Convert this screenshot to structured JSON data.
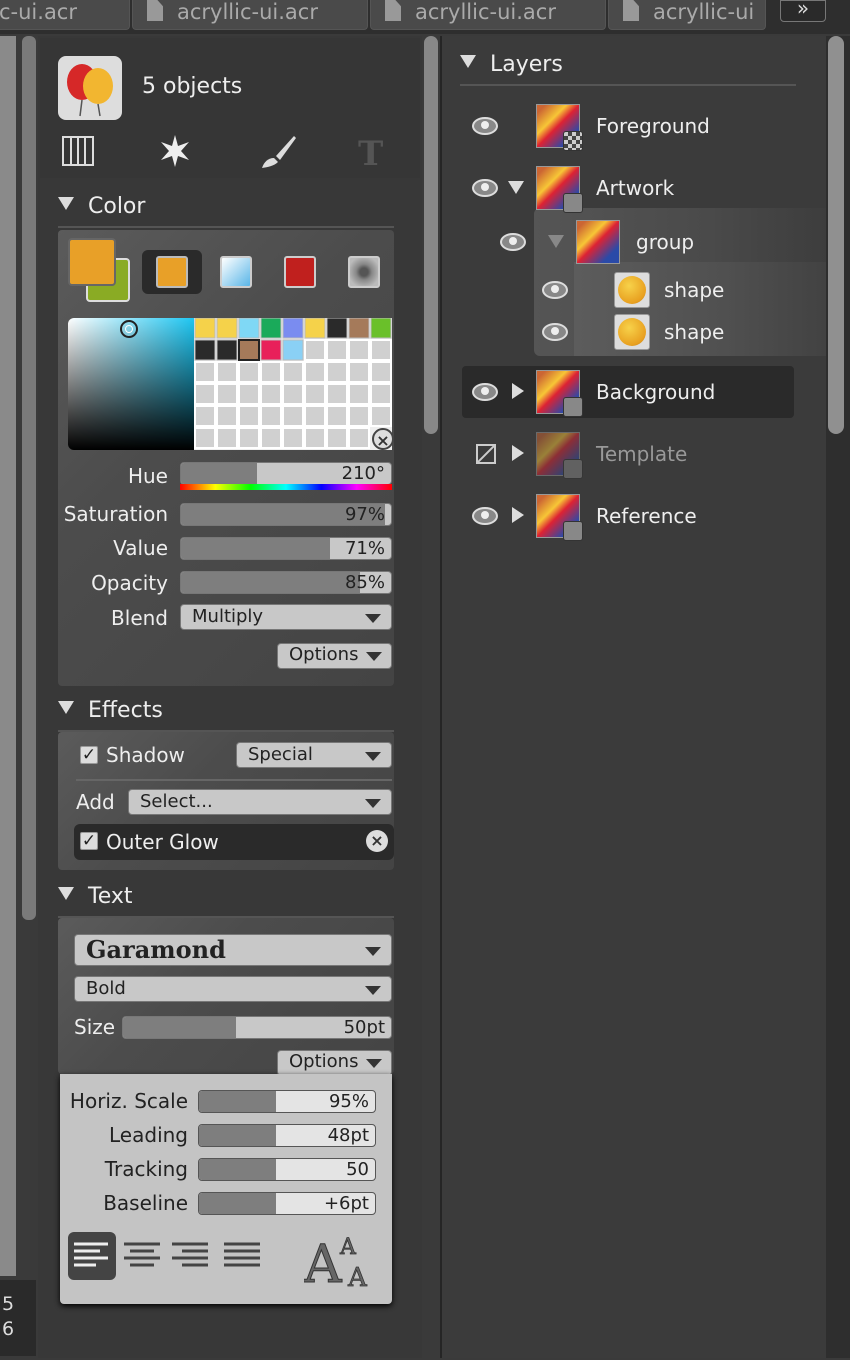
{
  "tabs": [
    {
      "label": "c-ui.acr"
    },
    {
      "label": "acryllic-ui.acr"
    },
    {
      "label": "acryllic-ui.acr"
    },
    {
      "label": "acryllic-ui"
    }
  ],
  "tab_more": "»",
  "status": {
    "line1": "5",
    "line2": "6"
  },
  "object_info": {
    "count_label": "5 objects"
  },
  "sections": {
    "color": "Color",
    "effects": "Effects",
    "text": "Text",
    "layers": "Layers"
  },
  "color": {
    "fg": "#e8a028",
    "bg": "#8aab24",
    "hue": {
      "label": "Hue",
      "value": "210°",
      "fill": 0.36
    },
    "saturation": {
      "label": "Saturation",
      "value": "97%",
      "fill": 0.97
    },
    "value": {
      "label": "Value",
      "value": "71%",
      "fill": 0.71
    },
    "opacity": {
      "label": "Opacity",
      "value": "85%",
      "fill": 0.85
    },
    "blend": {
      "label": "Blend",
      "value": "Multiply"
    },
    "options": "Options"
  },
  "effects": {
    "shadow": {
      "label": "Shadow",
      "mode": "Special"
    },
    "add": {
      "label": "Add",
      "placeholder": "Select..."
    },
    "outer_glow": {
      "label": "Outer Glow"
    }
  },
  "text": {
    "font": "Garamond",
    "weight": "Bold",
    "size": {
      "label": "Size",
      "value": "50pt",
      "fill": 0.42
    },
    "options": "Options",
    "horiz_scale": {
      "label": "Horiz. Scale",
      "value": "95%",
      "fill": 0.44
    },
    "leading": {
      "label": "Leading",
      "value": "48pt",
      "fill": 0.44
    },
    "tracking": {
      "label": "Tracking",
      "value": "50",
      "fill": 0.44
    },
    "baseline": {
      "label": "Baseline",
      "value": "+6pt",
      "fill": 0.44
    }
  },
  "layers": [
    {
      "name": "Foreground"
    },
    {
      "name": "Artwork"
    },
    {
      "name": "group"
    },
    {
      "name": "shape"
    },
    {
      "name": "shape"
    },
    {
      "name": "Background"
    },
    {
      "name": "Template"
    },
    {
      "name": "Reference"
    }
  ]
}
